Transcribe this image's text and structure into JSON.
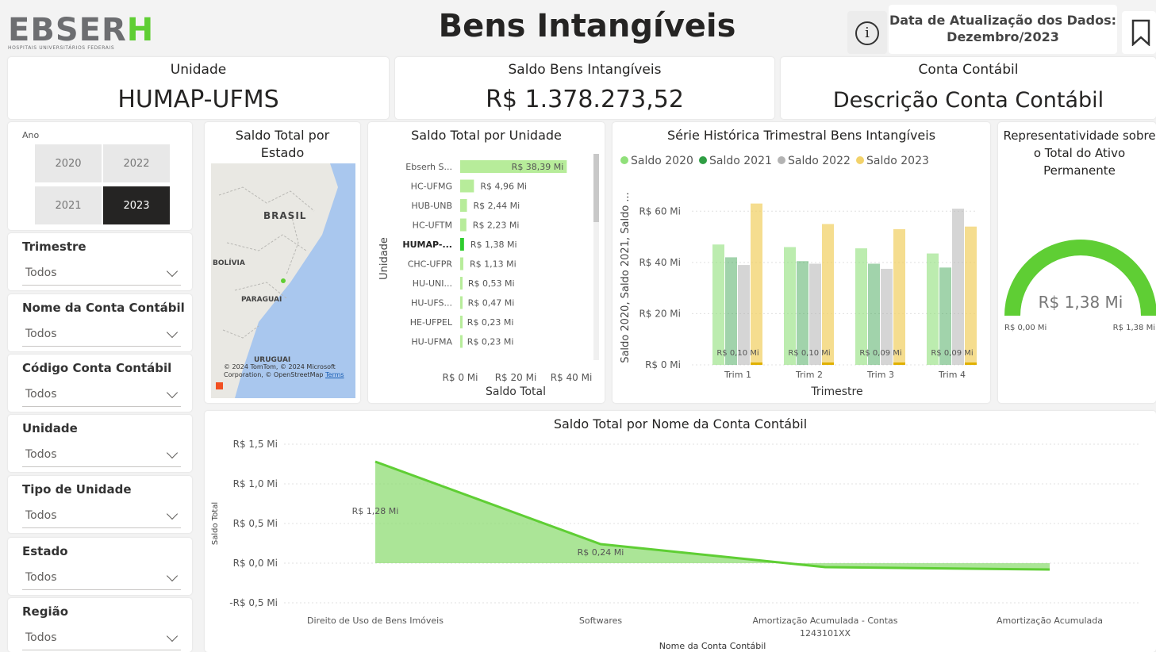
{
  "header": {
    "logo_text": "EBSERH",
    "logo_sub": "HOSPITAIS UNIVERSITÁRIOS FEDERAIS",
    "title": "Bens Intangíveis",
    "update_label": "Data de Atualização dos Dados:",
    "update_value": "Dezembro/2023",
    "info_icon": "info-icon",
    "bookmark_icon": "bookmark-icon"
  },
  "kpis": {
    "unidade_label": "Unidade",
    "unidade_value": "HUMAP-UFMS",
    "saldo_label": "Saldo Bens Intangíveis",
    "saldo_value": "R$ 1.378.273,52",
    "conta_label": "Conta Contábil",
    "conta_value": "Descrição Conta Contábil"
  },
  "filters": {
    "ano_label": "Ano",
    "years": [
      {
        "label": "2020",
        "selected": false
      },
      {
        "label": "2022",
        "selected": false
      },
      {
        "label": "2021",
        "selected": false
      },
      {
        "label": "2023",
        "selected": true
      }
    ],
    "slicers": [
      {
        "title": "Trimestre",
        "value": "Todos"
      },
      {
        "title": "Nome da Conta Contábil",
        "value": "Todos"
      },
      {
        "title": "Código Conta Contábil",
        "value": "Todos"
      },
      {
        "title": "Unidade",
        "value": "Todos"
      },
      {
        "title": "Tipo de Unidade",
        "value": "Todos"
      },
      {
        "title": "Estado",
        "value": "Todos"
      },
      {
        "title": "Região",
        "value": "Todos"
      }
    ]
  },
  "map": {
    "title": "Saldo Total por Estado",
    "labels": {
      "brasil": "BRASIL",
      "bolivia": "BOLÍVIA",
      "paraguai": "PARAGUAI",
      "uruguai": "URUGUAI"
    },
    "attribution": "© 2024 TomTom, © 2024 Microsoft Corporation, © OpenStreetMap",
    "terms": "Terms"
  },
  "colors": {
    "accent_green": "#5fce34",
    "saldo2020": "#90e07a",
    "saldo2021": "#2f9e44",
    "saldo2022": "#b3b3b3",
    "saldo2023": "#f2d26a"
  },
  "chart_data": [
    {
      "type": "bar",
      "orientation": "horizontal",
      "title": "Saldo Total por Unidade",
      "xlabel": "Saldo Total",
      "ylabel": "Unidade",
      "categories": [
        "Ebserh S...",
        "HC-UFMG",
        "HUB-UNB",
        "HC-UFTM",
        "HUMAP-...",
        "CHC-UFPR",
        "HU-UNI...",
        "HU-UFS...",
        "HE-UFPEL",
        "HU-UFMA"
      ],
      "values": [
        38.39,
        4.96,
        2.44,
        2.23,
        1.38,
        1.13,
        0.53,
        0.47,
        0.23,
        0.23
      ],
      "data_labels": [
        "R$ 38,39 Mi",
        "R$ 4,96 Mi",
        "R$ 2,44 Mi",
        "R$ 2,23 Mi",
        "R$ 1,38 Mi",
        "R$ 1,13 Mi",
        "R$ 0,53 Mi",
        "R$ 0,47 Mi",
        "R$ 0,23 Mi",
        "R$ 0,23 Mi"
      ],
      "highlighted": "HUMAP-...",
      "xticks": [
        "R$ 0 Mi",
        "R$ 20 Mi",
        "R$ 40 Mi"
      ],
      "xlim": [
        0,
        40
      ]
    },
    {
      "type": "bar",
      "title": "Série Histórica Trimestral Bens Intangíveis",
      "xlabel": "Trimestre",
      "ylabel": "Saldo 2020, Saldo 2021, Saldo ...",
      "categories": [
        "Trim 1",
        "Trim 2",
        "Trim 3",
        "Trim 4"
      ],
      "series": [
        {
          "name": "Saldo 2020",
          "values": [
            47,
            46,
            45.5,
            43.5
          ]
        },
        {
          "name": "Saldo 2021",
          "values": [
            42,
            40.5,
            39.5,
            38
          ]
        },
        {
          "name": "Saldo 2022",
          "values": [
            39,
            39.5,
            37.5,
            61
          ]
        },
        {
          "name": "Saldo 2023",
          "values": [
            63,
            55,
            53,
            54
          ]
        }
      ],
      "bar_labels": [
        "R$ 0,10 Mi",
        "R$ 0,10 Mi",
        "R$ 0,09 Mi",
        "R$ 0,09 Mi"
      ],
      "yticks": [
        "R$ 0 Mi",
        "R$ 20 Mi",
        "R$ 40 Mi",
        "R$ 60 Mi"
      ],
      "ylim": [
        0,
        70
      ],
      "legend": "top"
    },
    {
      "type": "gauge",
      "title": "Representatividade sobre o Total do Ativo Permanente",
      "value_label": "R$ 1,38 Mi",
      "min_label": "R$ 0,00 Mi",
      "max_label": "R$ 1,38 Mi",
      "fraction": 1.0
    },
    {
      "type": "area",
      "title": "Saldo Total por Nome da Conta Contábil",
      "xlabel": "Nome da Conta Contábil",
      "ylabel": "Saldo Total",
      "categories": [
        "Direito de Uso de Bens Imóveis",
        "Softwares",
        "Amortização Acumulada - Contas 1243101XX",
        "Amortização Acumulada"
      ],
      "values": [
        1.28,
        0.24,
        -0.05,
        -0.08
      ],
      "data_labels": [
        "R$ 1,28 Mi",
        "R$ 0,24 Mi",
        "",
        ""
      ],
      "yticks": [
        "-R$ 0,5 Mi",
        "R$ 0,0 Mi",
        "R$ 0,5 Mi",
        "R$ 1,0 Mi",
        "R$ 1,5 Mi"
      ],
      "ylim": [
        -0.5,
        1.5
      ]
    }
  ]
}
